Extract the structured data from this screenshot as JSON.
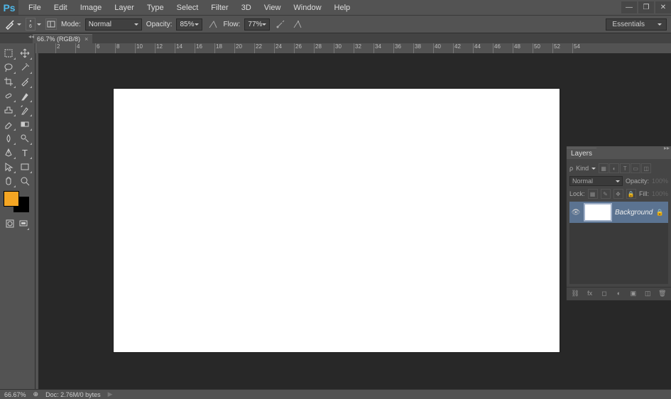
{
  "app_logo": "Ps",
  "menu": [
    "File",
    "Edit",
    "Image",
    "Layer",
    "Type",
    "Select",
    "Filter",
    "3D",
    "View",
    "Window",
    "Help"
  ],
  "options": {
    "brush_size": "6",
    "mode_label": "Mode:",
    "mode_value": "Normal",
    "opacity_label": "Opacity:",
    "opacity_value": "85%",
    "flow_label": "Flow:",
    "flow_value": "77%"
  },
  "workspace": "Essentials",
  "document": {
    "tab_title": "66.7% (RGB/8)"
  },
  "ruler_h": [
    "",
    "2",
    "4",
    "6",
    "8",
    "10",
    "12",
    "14",
    "16",
    "18",
    "20",
    "22",
    "24",
    "26",
    "28",
    "30",
    "32",
    "34",
    "36",
    "38",
    "40",
    "42",
    "44",
    "46",
    "48",
    "50",
    "52",
    "54"
  ],
  "colors": {
    "foreground": "#f5a623",
    "background": "#000000"
  },
  "layers_panel": {
    "title": "Layers",
    "kind_label": "Kind",
    "blend_mode": "Normal",
    "opacity_label": "Opacity:",
    "opacity_value": "100%",
    "lock_label": "Lock:",
    "fill_label": "Fill:",
    "fill_value": "100%",
    "layer_name": "Background"
  },
  "status": {
    "zoom": "66.67%",
    "doc_info": "Doc: 2.76M/0 bytes"
  }
}
